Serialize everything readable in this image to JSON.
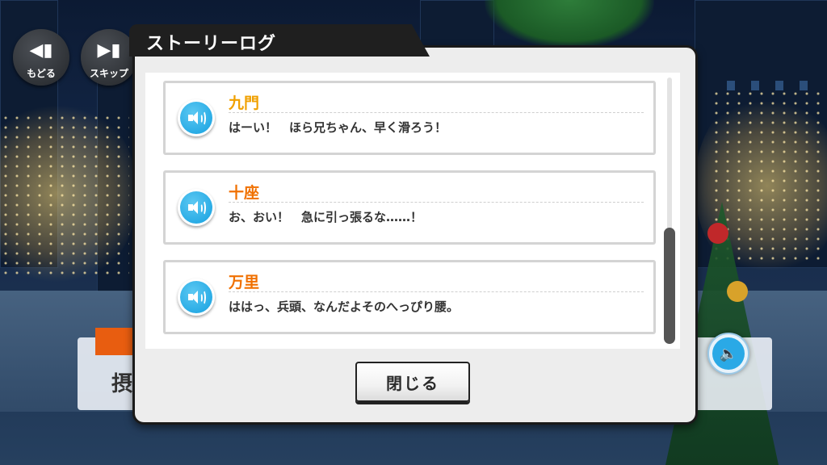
{
  "nav": {
    "back_label": "もどる",
    "skip_label": "スキップ"
  },
  "dialog": {
    "title": "ストーリーログ",
    "close_label": "閉じる",
    "entries": [
      {
        "speaker": "九門",
        "text": "はーい！　ほら兄ちゃん、早く滑ろう！",
        "name_color": "#f0a000"
      },
      {
        "speaker": "十座",
        "text": "お、おい！　急に引っ張るな……！",
        "name_color": "#f07000"
      },
      {
        "speaker": "万里",
        "text": "ははっ、兵頭、なんだよそのへっぴり腰。",
        "name_color": "#f07000"
      }
    ],
    "scroll_position_fraction": 1.0
  },
  "background": {
    "name_char": "摂"
  },
  "icons": {
    "back": "rewind-icon",
    "skip": "skip-forward-icon",
    "voice": "speaker-icon"
  },
  "colors": {
    "accent_blue": "#14a0e0",
    "name_gold": "#f0a000",
    "name_orange": "#f07000",
    "dialog_border": "#1a1a1a"
  }
}
